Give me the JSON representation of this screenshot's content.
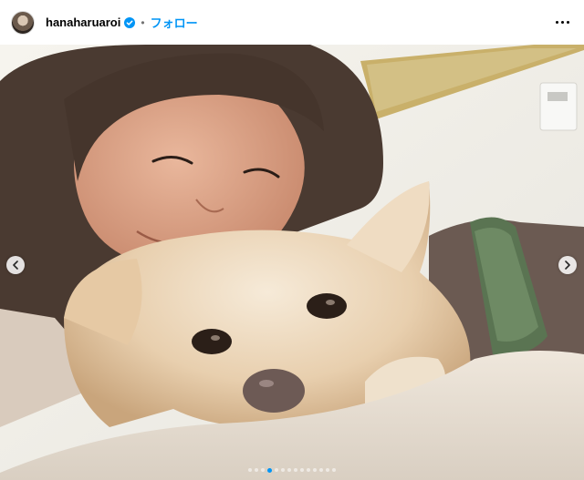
{
  "header": {
    "username": "hanaharuaroi",
    "separator": "•",
    "follow_label": "フォロー"
  },
  "icons": {
    "verified": "verified-badge-icon",
    "more": "more-options-icon",
    "prev": "chevron-left-icon",
    "next": "chevron-right-icon"
  },
  "colors": {
    "accent": "#0095f6",
    "text": "#000000",
    "muted": "#737373"
  },
  "carousel": {
    "total_slides": 14,
    "active_index": 3
  }
}
